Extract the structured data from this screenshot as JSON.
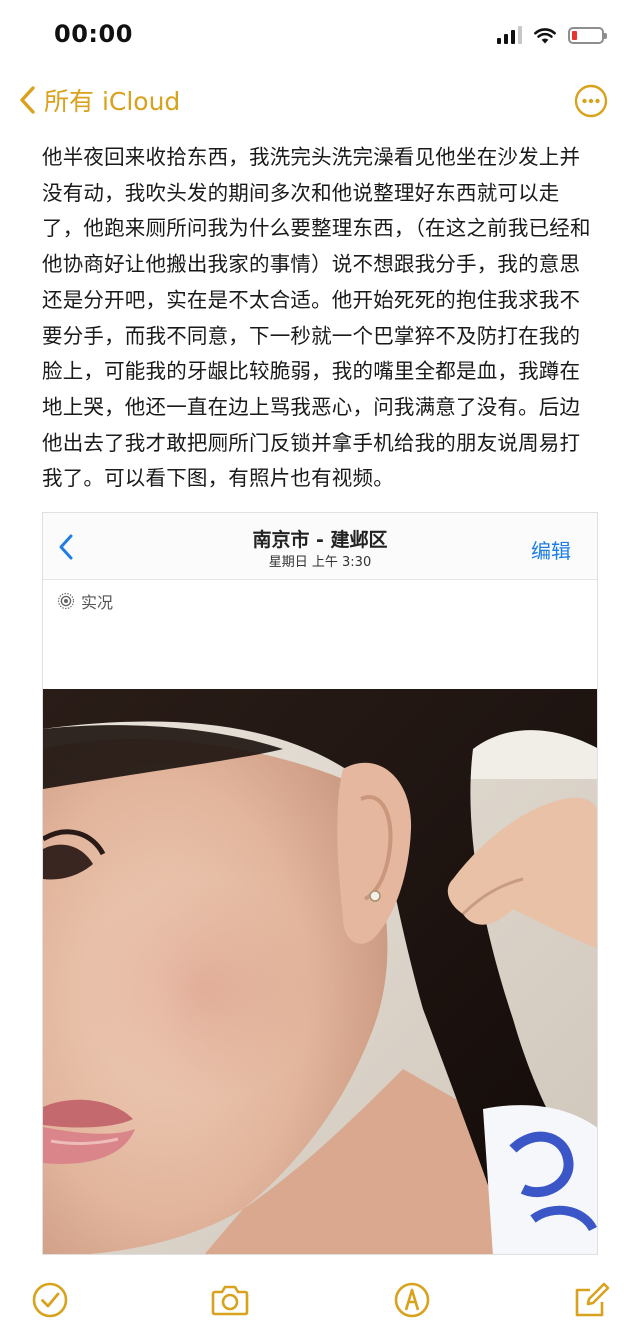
{
  "status_bar": {
    "time": "00:00"
  },
  "nav": {
    "back_label": "所有 iCloud",
    "accent_color": "#d8a21c"
  },
  "note": {
    "body": "他半夜回来收拾东西，我洗完头洗完澡看见他坐在沙发上并没有动，我吹头发的期间多次和他说整理好东西就可以走了，他跑来厕所问我为什么要整理东西，（在这之前我已经和他协商好让他搬出我家的事情）说不想跟我分手，我的意思还是分开吧，实在是不太合适。他开始死死的抱住我求我不要分手，而我不同意，下一秒就一个巴掌猝不及防打在我的脸上，可能我的牙龈比较脆弱，我的嘴里全都是血，我蹲在地上哭，他还一直在边上骂我恶心，问我满意了没有。后边他出去了我才敢把厕所门反锁并拿手机给我的朋友说周易打我了。可以看下图，有照片也有视频。"
  },
  "embedded_photo_screen": {
    "title": "南京市 - 建邺区",
    "subtitle": "星期日 上午 3:30",
    "edit_label": "编辑",
    "live_label": "实况",
    "edit_color": "#1f7ee3"
  },
  "toolbar": {
    "icons": [
      "checklist-icon",
      "camera-icon",
      "markup-pen-icon",
      "compose-icon"
    ]
  }
}
